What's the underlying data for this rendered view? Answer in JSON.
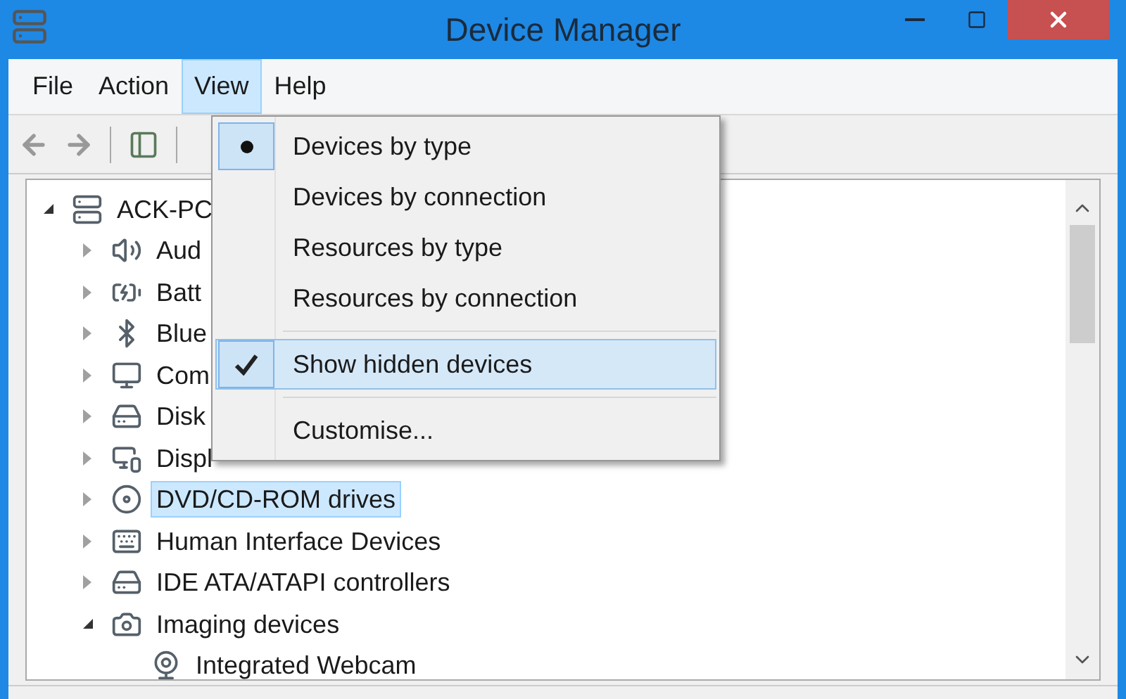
{
  "window": {
    "title": "Device Manager"
  },
  "menu_bar": [
    {
      "label": "File",
      "selected": false
    },
    {
      "label": "Action",
      "selected": false
    },
    {
      "label": "View",
      "selected": true
    },
    {
      "label": "Help",
      "selected": false
    }
  ],
  "view_menu": [
    {
      "kind": "radio",
      "label": "Devices by type",
      "selected": true,
      "highlighted": false
    },
    {
      "kind": "radio",
      "label": "Devices by connection",
      "selected": false,
      "highlighted": false
    },
    {
      "kind": "radio",
      "label": "Resources by type",
      "selected": false,
      "highlighted": false
    },
    {
      "kind": "radio",
      "label": "Resources by connection",
      "selected": false,
      "highlighted": false
    },
    {
      "kind": "separator"
    },
    {
      "kind": "check",
      "label": "Show hidden devices",
      "checked": true,
      "highlighted": true
    },
    {
      "kind": "separator"
    },
    {
      "kind": "command",
      "label": "Customise...",
      "highlighted": false
    }
  ],
  "tree": [
    {
      "label": "ACK-PC",
      "expanded": true,
      "selected": false,
      "children": [
        {
          "label": "Aud",
          "expanded": false,
          "selected": false
        },
        {
          "label": "Batt",
          "expanded": false,
          "selected": false
        },
        {
          "label": "Blue",
          "expanded": false,
          "selected": false
        },
        {
          "label": "Com",
          "expanded": false,
          "selected": false
        },
        {
          "label": "Disk",
          "expanded": false,
          "selected": false
        },
        {
          "label": "Displ",
          "expanded": false,
          "selected": false
        },
        {
          "label": "DVD/CD-ROM drives",
          "expanded": false,
          "selected": true
        },
        {
          "label": "Human Interface Devices",
          "expanded": false,
          "selected": false
        },
        {
          "label": "IDE ATA/ATAPI controllers",
          "expanded": false,
          "selected": false
        },
        {
          "label": "Imaging devices",
          "expanded": true,
          "selected": false,
          "children": [
            {
              "label": "Integrated Webcam",
              "selected": false
            }
          ]
        }
      ]
    }
  ]
}
